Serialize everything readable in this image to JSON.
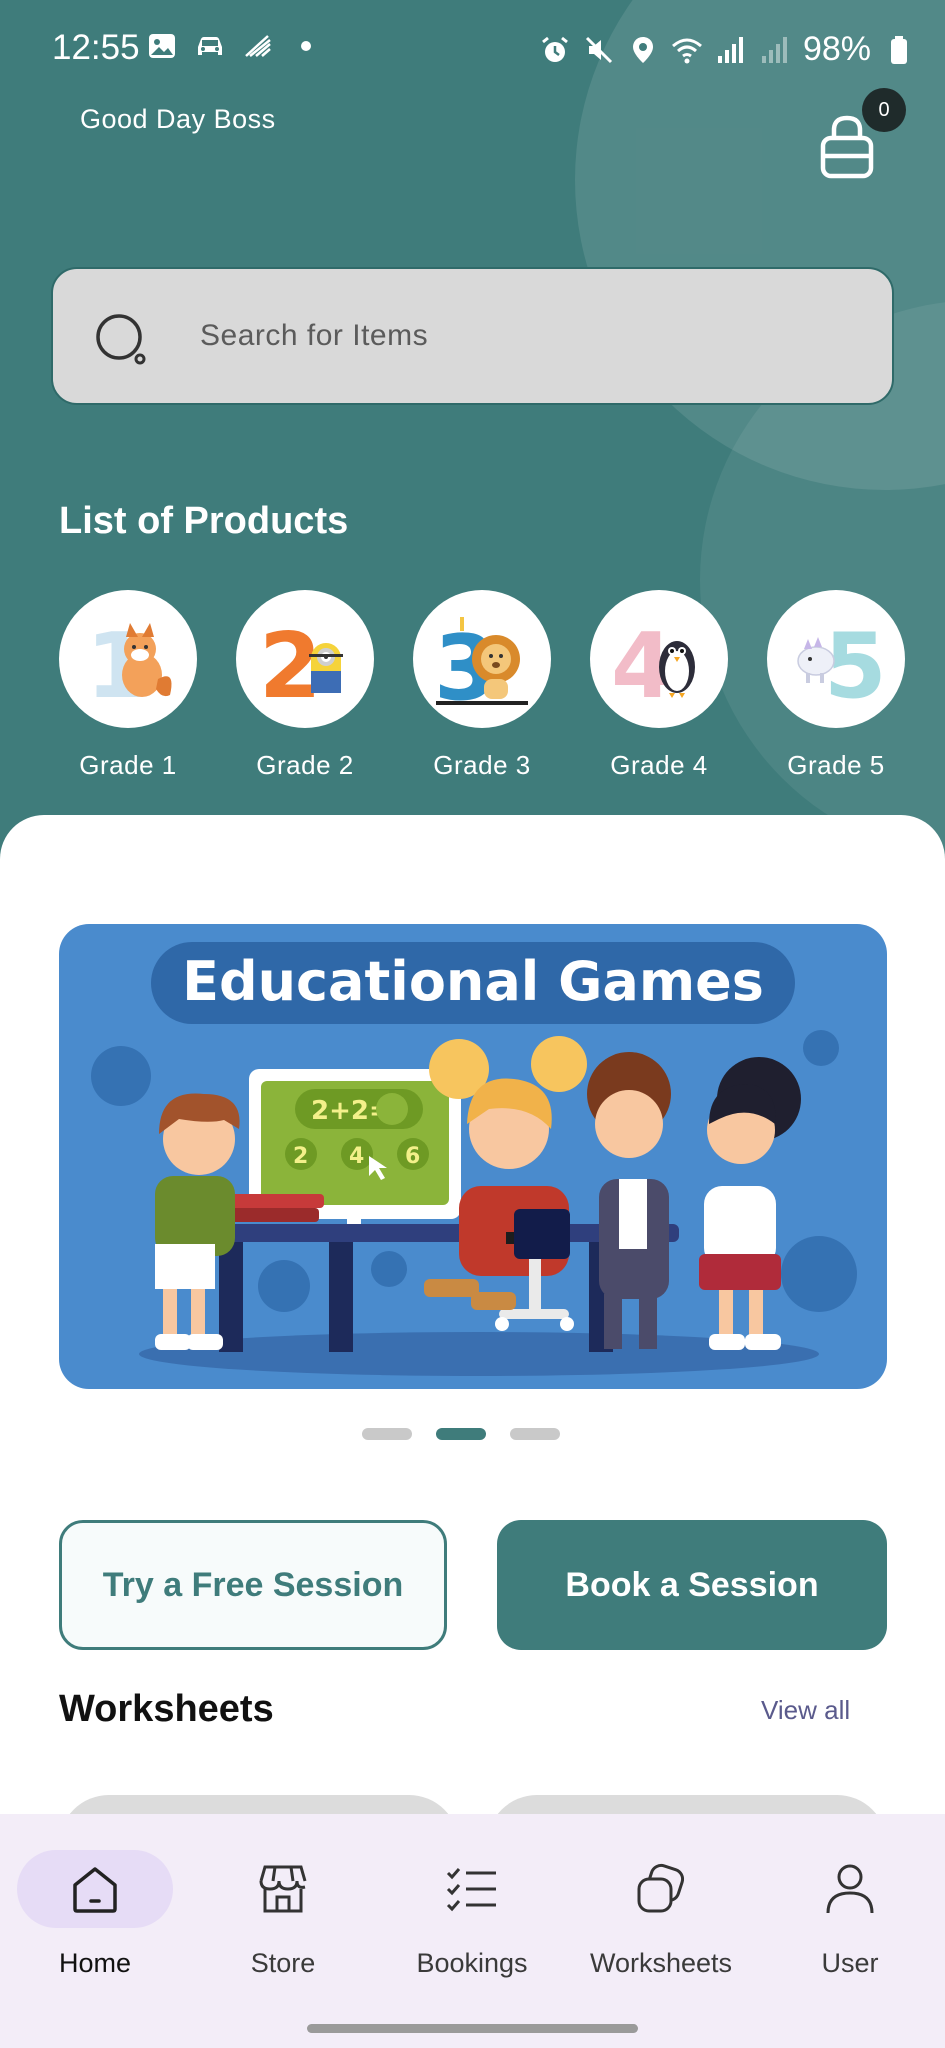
{
  "status_bar": {
    "time": "12:55",
    "battery": "98%",
    "left_icons": [
      "gallery-icon",
      "car-icon",
      "wifi-calling-icon",
      "dot-icon"
    ],
    "right_icons": [
      "alarm-icon",
      "mute-icon",
      "location-icon",
      "wifi-icon",
      "signal-icon",
      "signal-weak-icon",
      "battery-icon"
    ]
  },
  "header": {
    "greeting": "Good Day Boss",
    "cart_count": "0"
  },
  "search": {
    "placeholder": "Search for Items"
  },
  "products": {
    "title": "List of Products",
    "grades": [
      {
        "label": "Grade 1",
        "numeral": "1",
        "color": "#cfe4f1",
        "icon": "fox-icon"
      },
      {
        "label": "Grade 2",
        "numeral": "2",
        "color": "#f07a2e",
        "icon": "minion-icon"
      },
      {
        "label": "Grade 3",
        "numeral": "3",
        "color": "#2f8fc7",
        "icon": "lion-icon"
      },
      {
        "label": "Grade 4",
        "numeral": "4",
        "color": "#f2bcc8",
        "icon": "penguin-icon"
      },
      {
        "label": "Grade 5",
        "numeral": "5",
        "color": "#a6dbe0",
        "icon": "dinosaur-icon"
      }
    ]
  },
  "banner": {
    "title": "Educational Games",
    "equation": "2+2=",
    "options": [
      "2",
      "4",
      "6"
    ],
    "active_slide": 2,
    "total_slides": 3
  },
  "actions": {
    "free_session": "Try a Free Session",
    "book_session": "Book a Session"
  },
  "worksheets": {
    "title": "Worksheets",
    "view_all": "View all"
  },
  "nav": {
    "items": [
      {
        "label": "Home",
        "icon": "home-icon",
        "active": true
      },
      {
        "label": "Store",
        "icon": "store-icon",
        "active": false
      },
      {
        "label": "Bookings",
        "icon": "checklist-icon",
        "active": false
      },
      {
        "label": "Worksheets",
        "icon": "worksheets-icon",
        "active": false
      },
      {
        "label": "User",
        "icon": "user-icon",
        "active": false
      }
    ]
  },
  "colors": {
    "primary": "#3f7c7b",
    "nav_bg": "#f3edf8",
    "nav_active": "#e6dcf6",
    "banner_bg": "#4a8bcd"
  }
}
